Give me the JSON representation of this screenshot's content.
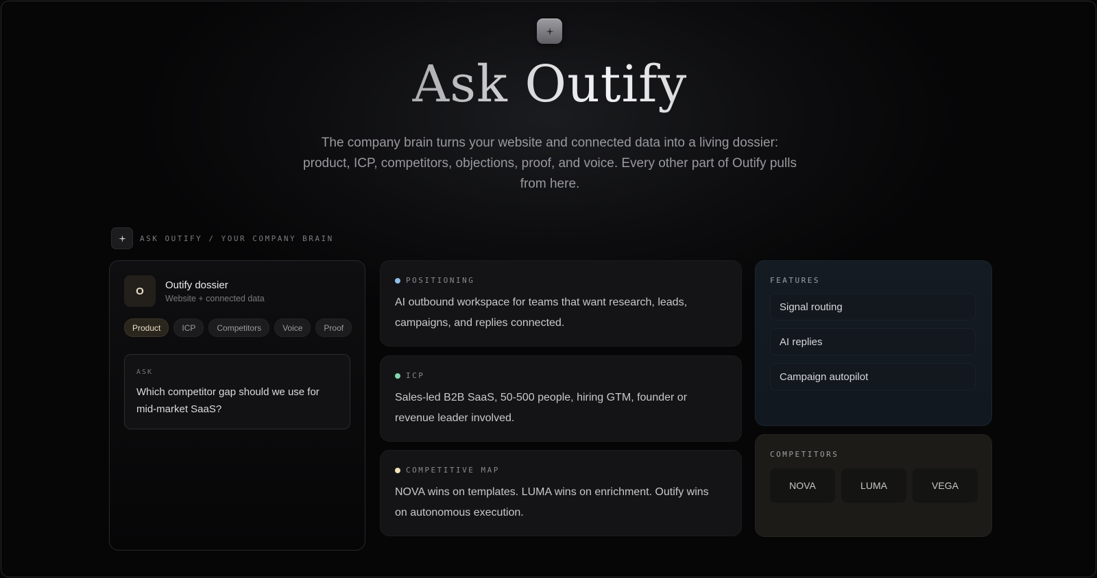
{
  "hero": {
    "title": "Ask Outify",
    "subtitle": "The company brain turns your website and connected data into a living dossier: product, ICP, competitors, objections, proof, and voice. Every other part of Outify pulls from here."
  },
  "breadcrumb": {
    "text": "ASK OUTIFY / YOUR COMPANY BRAIN"
  },
  "dossier": {
    "avatar": "O",
    "title": "Outify dossier",
    "subtitle": "Website + connected data",
    "chips": [
      "Product",
      "ICP",
      "Competitors",
      "Voice",
      "Proof"
    ],
    "active_chip": "Product",
    "ask_label": "ASK",
    "ask_text": "Which competitor gap should we use for mid-market SaaS?"
  },
  "cards": [
    {
      "label": "POSITIONING",
      "dot_color": "#8fc0ea",
      "text": "AI outbound workspace for teams that want research, leads, campaigns, and replies connected."
    },
    {
      "label": "ICP",
      "dot_color": "#7fd8b0",
      "text": "Sales-led B2B SaaS, 50-500 people, hiring GTM, founder or revenue leader involved."
    },
    {
      "label": "COMPETITIVE MAP",
      "dot_color": "#efe3b4",
      "text": "NOVA wins on templates. LUMA wins on enrichment. Outify wins on autonomous execution."
    }
  ],
  "features": {
    "label": "FEATURES",
    "items": [
      "Signal routing",
      "AI replies",
      "Campaign autopilot"
    ]
  },
  "competitors": {
    "label": "COMPETITORS",
    "items": [
      "NOVA",
      "LUMA",
      "VEGA"
    ]
  }
}
